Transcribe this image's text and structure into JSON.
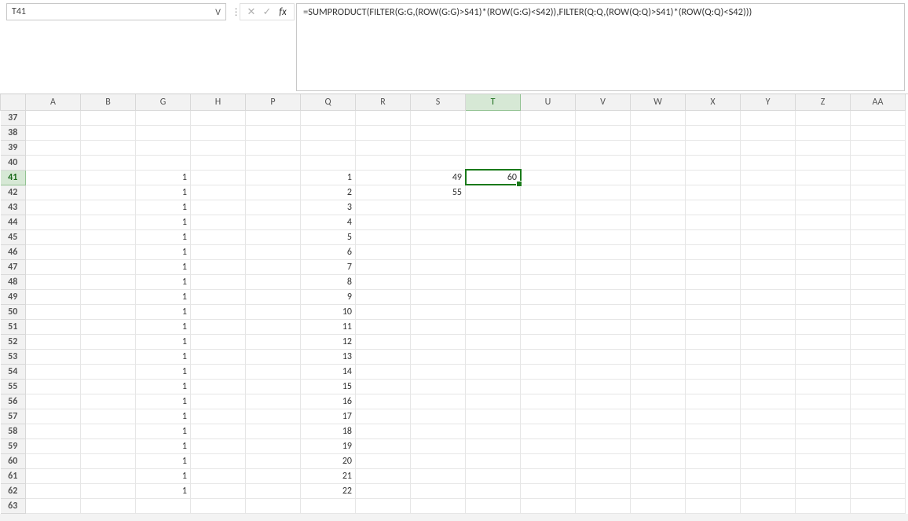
{
  "nameBox": {
    "value": "T41"
  },
  "formulaBar": {
    "value": "=SUMPRODUCT(FILTER(G:G,(ROW(G:G)>S41)*(ROW(G:G)<S42)),FILTER(Q:Q,(ROW(Q:Q)>S41)*(ROW(Q:Q)<S42)))"
  },
  "fx": {
    "label": "fx",
    "cancel": "✕",
    "enter": "✓",
    "sep": "⋮"
  },
  "nameBoxChevron": "ᐯ",
  "columns": [
    "A",
    "B",
    "G",
    "H",
    "P",
    "Q",
    "R",
    "S",
    "T",
    "U",
    "V",
    "W",
    "X",
    "Y",
    "Z",
    "AA"
  ],
  "rows": [
    37,
    38,
    39,
    40,
    41,
    42,
    43,
    44,
    45,
    46,
    47,
    48,
    49,
    50,
    51,
    52,
    53,
    54,
    55,
    56,
    57,
    58,
    59,
    60,
    61,
    62,
    63
  ],
  "selectedCell": {
    "row": 41,
    "col": "T"
  },
  "cells": {
    "G41": "1",
    "G42": "1",
    "G43": "1",
    "G44": "1",
    "G45": "1",
    "G46": "1",
    "G47": "1",
    "G48": "1",
    "G49": "1",
    "G50": "1",
    "G51": "1",
    "G52": "1",
    "G53": "1",
    "G54": "1",
    "G55": "1",
    "G56": "1",
    "G57": "1",
    "G58": "1",
    "G59": "1",
    "G60": "1",
    "G61": "1",
    "G62": "1",
    "Q41": "1",
    "Q42": "2",
    "Q43": "3",
    "Q44": "4",
    "Q45": "5",
    "Q46": "6",
    "Q47": "7",
    "Q48": "8",
    "Q49": "9",
    "Q50": "10",
    "Q51": "11",
    "Q52": "12",
    "Q53": "13",
    "Q54": "14",
    "Q55": "15",
    "Q56": "16",
    "Q57": "17",
    "Q58": "18",
    "Q59": "19",
    "Q60": "20",
    "Q61": "21",
    "Q62": "22",
    "S41": "49",
    "S42": "55",
    "T41": "60"
  }
}
